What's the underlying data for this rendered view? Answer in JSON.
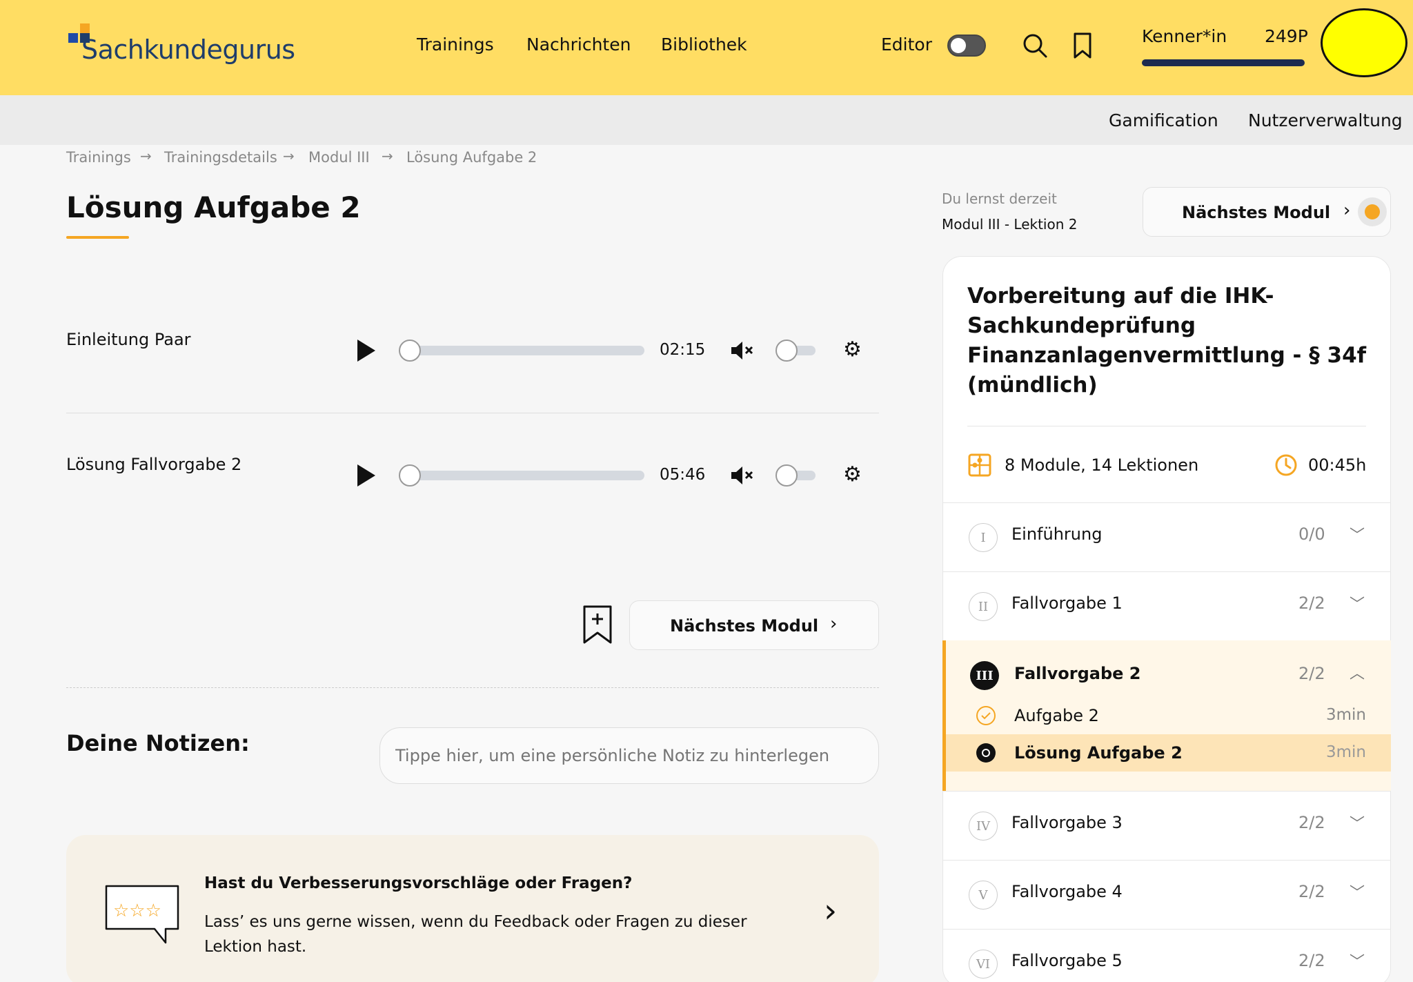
{
  "header": {
    "logo_text": "Sachkundegurus",
    "nav": [
      "Trainings",
      "Nachrichten",
      "Bibliothek"
    ],
    "editor_label": "Editor",
    "rank": "Kenner*in",
    "points": "249P",
    "progress_fraction": 1.0
  },
  "subnav": [
    "Gamification",
    "Nutzerverwaltung"
  ],
  "breadcrumb": [
    "Trainings",
    "Trainingsdetails",
    "Modul III",
    "Lösung Aufgabe 2"
  ],
  "page_title": "Lösung Aufgabe 2",
  "audio": [
    {
      "label": "Einleitung Paar",
      "time": "02:15"
    },
    {
      "label": "Lösung Fallvorgabe 2",
      "time": "05:46"
    }
  ],
  "next_module_label": "Nächstes Modul",
  "notes": {
    "label": "Deine Notizen:",
    "placeholder": "Tippe hier, um eine persönliche Notiz zu hinterlegen"
  },
  "feedback": {
    "title": "Hast du Verbesserungsvorschläge oder Fragen?",
    "text": "Lass’ es uns gerne wissen, wenn du Feedback oder Fragen zu dieser Lektion hast."
  },
  "sidebar": {
    "learning_label": "Du lernst derzeit",
    "learning_value": "Modul III - Lektion 2",
    "course_title": "Vorbereitung auf die IHK-Sachkundeprüfung Finanzanlagenvermittlung - § 34f (mündlich)",
    "modules_count": "8 Module, 14 Lektionen",
    "duration": "00:45h",
    "modules": [
      {
        "numeral": "I",
        "name": "Einführung",
        "count": "0/0"
      },
      {
        "numeral": "II",
        "name": "Fallvorgabe 1",
        "count": "2/2"
      },
      {
        "numeral": "III",
        "name": "Fallvorgabe 2",
        "count": "2/2"
      },
      {
        "numeral": "IV",
        "name": "Fallvorgabe 3",
        "count": "2/2"
      },
      {
        "numeral": "V",
        "name": "Fallvorgabe 4",
        "count": "2/2"
      },
      {
        "numeral": "VI",
        "name": "Fallvorgabe 5",
        "count": "2/2"
      }
    ],
    "lessons": [
      {
        "name": "Aufgabe 2",
        "time": "3min"
      },
      {
        "name": "Lösung Aufgabe 2",
        "time": "3min"
      }
    ]
  },
  "colors": {
    "header": "#ffdd63",
    "accent": "#f5a623",
    "navy": "#1d2b4f"
  }
}
